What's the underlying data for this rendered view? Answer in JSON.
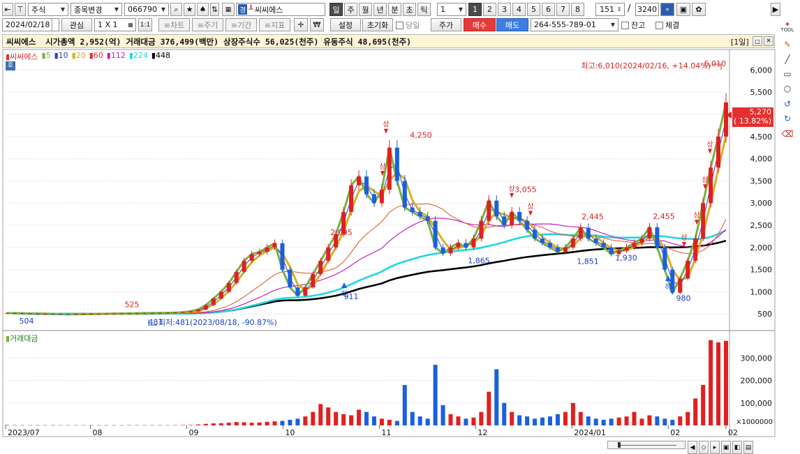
{
  "toolbar1": {
    "pin_icon": "pin-icon",
    "lock_icon": "lock-icon",
    "market_type": "주식",
    "item_change": "종목변경",
    "code": "066790",
    "stock_name": "씨씨에스",
    "name_prefix_1": "경",
    "name_prefix_2": "┸",
    "periods": [
      "일",
      "주",
      "월",
      "년",
      "분",
      "초",
      "틱"
    ],
    "period_count": "1",
    "chart_counts": [
      "1",
      "2",
      "3",
      "4",
      "5",
      "6",
      "7",
      "8"
    ],
    "page_current": "151",
    "page_sep": "/",
    "page_total": "3240"
  },
  "toolbar2": {
    "date": "2024/02/18",
    "watch": "관심",
    "layout": "1 X 1",
    "one_one": "1:1",
    "tabs": [
      "≡차트",
      "≡주기",
      "≡기간",
      "≡지표"
    ],
    "krw": "₩",
    "settings": "설정",
    "reset": "초기화",
    "today": "당일",
    "price_btn": "주가",
    "buy": "매수",
    "sell": "매도",
    "account": "264-555-789-01",
    "balance": "잔고",
    "filled": "체결"
  },
  "infobar": {
    "text": "씨씨에스  시가총액 2,952(억) 거래대금 376,499(백만) 상장주식수 56,025(천주) 유동주식 48,695(천주)",
    "period": "[1일]"
  },
  "price_panel": {
    "tag": "호",
    "legend": [
      {
        "label": "씨씨에스",
        "color": "#e03030"
      },
      {
        "label": "5",
        "color": "#7ab040"
      },
      {
        "label": "10",
        "color": "#2a3fc0"
      },
      {
        "label": "20",
        "color": "#d8b020"
      },
      {
        "label": "60",
        "color": "#e03030"
      },
      {
        "label": "112",
        "color": "#c020c0"
      },
      {
        "label": "224",
        "color": "#20d8e0"
      },
      {
        "label": "448",
        "color": "#000000"
      }
    ],
    "high_annotation": "최고:6,010(2024/02/16, +14.04%)",
    "low_annotation": "최저:481(2023/08/18, -90.87%)",
    "current_price": "5,270",
    "current_change": "( 13.82%)",
    "labels": [
      "6,010",
      "4,250",
      "2,095",
      "525",
      "504",
      "481",
      "911",
      "1,865",
      "3,055",
      "2,445",
      "1,851",
      "1,930",
      "2,455",
      "980"
    ],
    "limit_up": "상",
    "limit_down": "하"
  },
  "volume_panel": {
    "legend": "거래대금",
    "unit": "×1000000"
  },
  "chart_data": [
    {
      "type": "line",
      "title": "씨씨에스",
      "y_ticks": [
        "6,000",
        "5,500",
        "5,000",
        "4,500",
        "4,000",
        "3,500",
        "3,000",
        "2,500",
        "2,000",
        "1,500",
        "1,000",
        "500"
      ],
      "ylim": [
        220,
        6400
      ],
      "x_labels": [
        "2023/07",
        "08",
        "09",
        "10",
        "11",
        "12",
        "2024/01",
        "02",
        "02"
      ],
      "series": [
        {
          "name": "씨씨에스",
          "close": [
            520,
            515,
            510,
            505,
            500,
            500,
            498,
            495,
            493,
            495,
            497,
            500,
            502,
            505,
            508,
            510,
            512,
            515,
            518,
            520,
            522,
            525,
            530,
            540,
            560,
            600,
            700,
            850,
            1000,
            1200,
            1450,
            1700,
            1850,
            1900,
            2000,
            2095,
            1500,
            1100,
            911,
            1100,
            1400,
            1700,
            2000,
            2300,
            2800,
            3400,
            3600,
            3200,
            3000,
            3300,
            4250,
            3500,
            2900,
            2800,
            2700,
            2600,
            2000,
            1865,
            2000,
            2100,
            2000,
            2200,
            2600,
            3055,
            2700,
            2500,
            2800,
            2600,
            2400,
            2200,
            2100,
            2000,
            1900,
            2000,
            2200,
            2445,
            2200,
            2100,
            2000,
            1851,
            1930,
            2000,
            2100,
            2200,
            2455,
            2000,
            1500,
            980,
            1300,
            1700,
            2200,
            3000,
            3800,
            4500,
            5270
          ]
        }
      ],
      "ma_periods": [
        "5",
        "10",
        "20",
        "60",
        "112",
        "224",
        "448"
      ]
    },
    {
      "type": "bar",
      "title": "거래대금",
      "y_ticks": [
        "300,000",
        "200,000",
        "100,000"
      ],
      "ylim": [
        0,
        410000
      ],
      "values": [
        2000,
        1500,
        1200,
        1000,
        900,
        1100,
        1300,
        1000,
        900,
        800,
        1100,
        1200,
        1000,
        900,
        800,
        1000,
        1200,
        1300,
        1100,
        1000,
        900,
        1000,
        1200,
        1500,
        2000,
        4000,
        7000,
        9000,
        10000,
        12000,
        15000,
        14000,
        12000,
        13000,
        16000,
        18000,
        20000,
        25000,
        30000,
        40000,
        60000,
        95000,
        80000,
        60000,
        50000,
        45000,
        70000,
        60000,
        40000,
        30000,
        25000,
        20000,
        180000,
        60000,
        40000,
        30000,
        270000,
        90000,
        50000,
        40000,
        30000,
        35000,
        60000,
        150000,
        250000,
        100000,
        60000,
        45000,
        40000,
        30000,
        35000,
        40000,
        50000,
        60000,
        100000,
        60000,
        40000,
        30000,
        25000,
        30000,
        35000,
        40000,
        60000,
        30000,
        45000,
        40000,
        30000,
        25000,
        40000,
        60000,
        120000,
        180000,
        380000,
        370000,
        376499
      ]
    }
  ],
  "right_toolbar": [
    "TOOL",
    "pencil-icon",
    "line-icon",
    "rect-icon",
    "circle-icon",
    "undo-icon",
    "redo-icon",
    "eraser-icon"
  ]
}
